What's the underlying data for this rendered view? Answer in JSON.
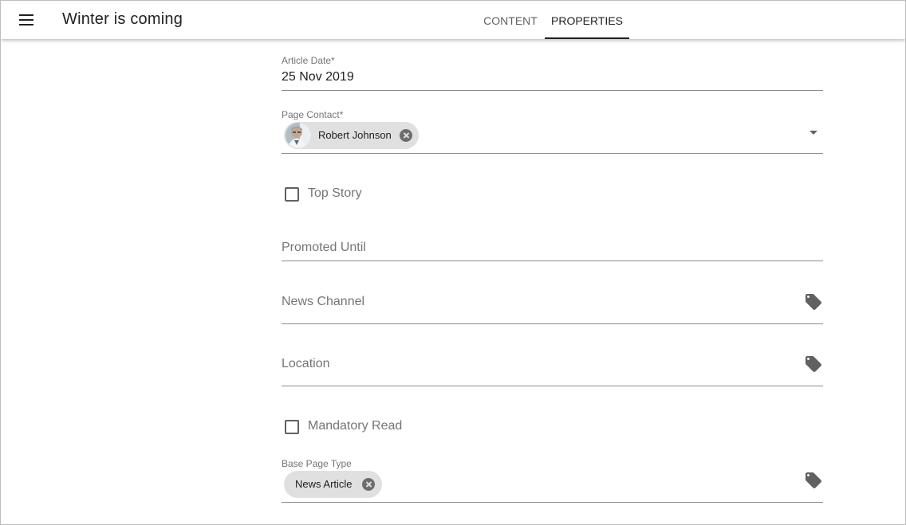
{
  "header": {
    "title": "Winter is coming",
    "menu_icon": "hamburger-menu-icon",
    "tabs": [
      {
        "label": "CONTENT",
        "active": false
      },
      {
        "label": "PROPERTIES",
        "active": true
      }
    ]
  },
  "form": {
    "article_date": {
      "label": "Article Date*",
      "value": "25 Nov 2019"
    },
    "page_contact": {
      "label": "Page Contact*",
      "chip": "Robert Johnson",
      "avatar_icon": "user-avatar",
      "dropdown_icon": "arrow-drop-down-icon"
    },
    "top_story": {
      "label": "Top Story",
      "checked": false
    },
    "promoted_until": {
      "placeholder": "Promoted Until"
    },
    "news_channel": {
      "placeholder": "News Channel",
      "icon": "tag-icon"
    },
    "location": {
      "placeholder": "Location",
      "icon": "tag-icon"
    },
    "mandatory_read": {
      "label": "Mandatory Read",
      "checked": false
    },
    "base_page_type": {
      "label": "Base Page Type",
      "chip": "News Article",
      "icon": "tag-icon"
    }
  },
  "colors": {
    "accent": "#212121",
    "chip_bg": "#e0e0e0",
    "secondary_text": "#757575",
    "icon": "#616161"
  }
}
